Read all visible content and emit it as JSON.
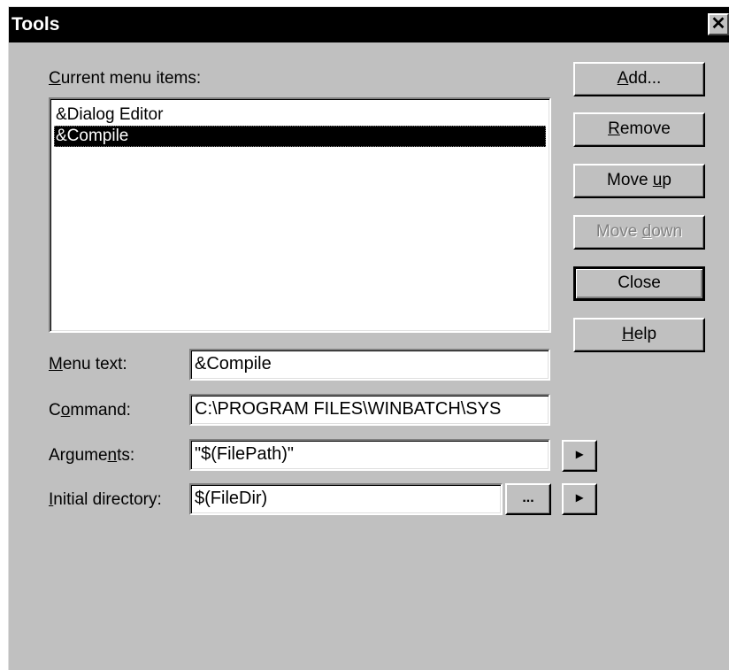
{
  "window": {
    "title": "Tools",
    "close_glyph": "✕"
  },
  "list": {
    "label_pre": "",
    "label_ul": "C",
    "label_post": "urrent menu items:",
    "items": [
      "&Dialog Editor",
      "&Compile"
    ],
    "selected_index": 1
  },
  "buttons": {
    "add": {
      "pre": "",
      "ul": "A",
      "post": "dd..."
    },
    "remove": {
      "pre": "",
      "ul": "R",
      "post": "emove"
    },
    "move_up": {
      "pre": "Move ",
      "ul": "u",
      "post": "p"
    },
    "move_down": {
      "pre": "Move ",
      "ul": "d",
      "post": "own"
    },
    "close": {
      "label": "Close"
    },
    "help": {
      "pre": "",
      "ul": "H",
      "post": "elp"
    }
  },
  "fields": {
    "menu_text": {
      "label_pre": "",
      "label_ul": "M",
      "label_post": "enu text:",
      "value": "&Compile"
    },
    "command": {
      "label_pre": "C",
      "label_ul": "o",
      "label_post": "mmand:",
      "value": "C:\\PROGRAM FILES\\WINBATCH\\SYS"
    },
    "arguments": {
      "label_pre": "Argume",
      "label_ul": "n",
      "label_post": "ts:",
      "value": "\"$(FilePath)\""
    },
    "initial_directory": {
      "label_pre": "",
      "label_ul": "I",
      "label_post": "nitial directory:",
      "value": "$(FileDir)"
    }
  },
  "small_buttons": {
    "browse": "...",
    "arguments_menu": "▸",
    "directory_menu": "▸"
  },
  "colors": {
    "face": "#c0c0c0",
    "titlebar": "#000000",
    "selection": "#000000",
    "disabled_text": "#808080"
  }
}
